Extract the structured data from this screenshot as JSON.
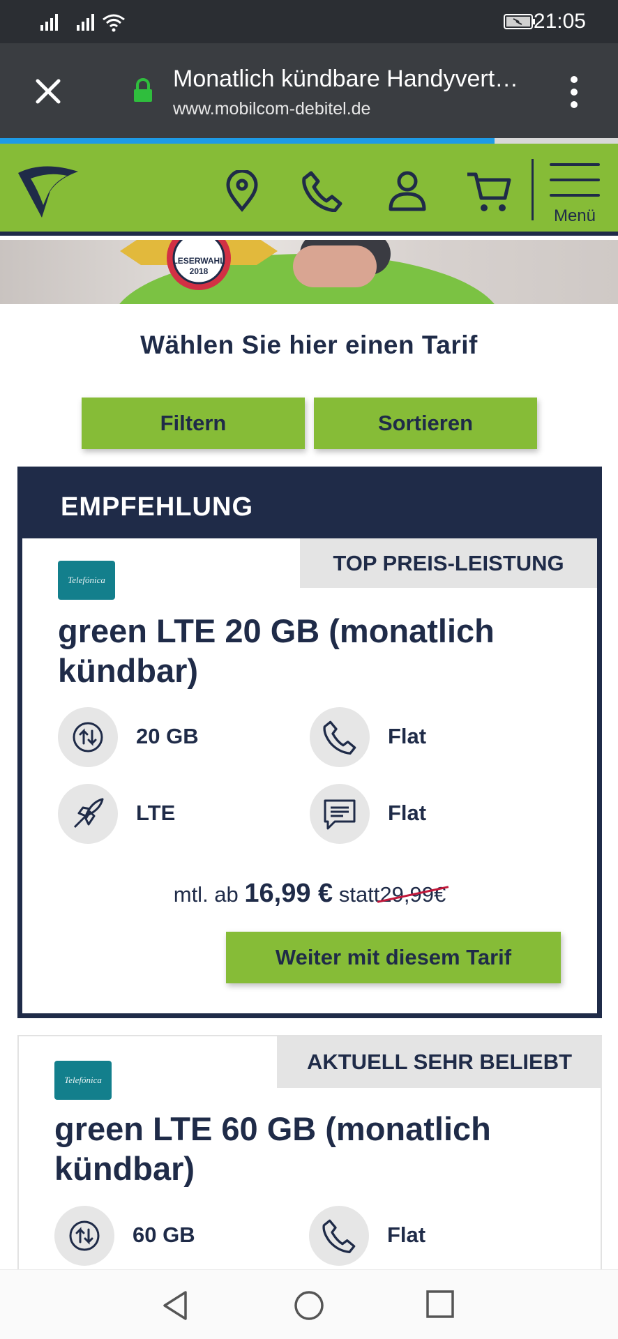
{
  "status_bar": {
    "time": "21:05"
  },
  "browser": {
    "title": "Monatlich kündbare Handyvert…",
    "url": "www.mobilcom-debitel.de",
    "load_progress": 0.8
  },
  "site_header": {
    "menu_label": "Menü",
    "icons": [
      "location-icon",
      "phone-icon",
      "user-icon",
      "cart-icon",
      "menu-icon"
    ]
  },
  "hero": {
    "badge_text": "LESERWAHL",
    "badge_year": "2018"
  },
  "section_title": "Wählen Sie hier einen Tarif",
  "actions": {
    "filter_label": "Filtern",
    "sort_label": "Sortieren"
  },
  "tariffs": [
    {
      "section_label": "EMPFEHLUNG",
      "tag": "TOP PREIS-LEISTUNG",
      "provider": "Telefónica",
      "title_line1": "green LTE 20 GB (monatlich",
      "title_line2": "kündbar)",
      "features": [
        {
          "icon": "data-transfer-icon",
          "label": "20 GB"
        },
        {
          "icon": "phone-icon",
          "label": "Flat"
        },
        {
          "icon": "rocket-icon",
          "label": "LTE"
        },
        {
          "icon": "message-icon",
          "label": "Flat"
        }
      ],
      "price_prefix": "mtl. ab",
      "price": "16,99 €",
      "price_mid": "statt",
      "price_old": "29,99€",
      "cta": "Weiter mit diesem Tarif"
    },
    {
      "tag": "AKTUELL SEHR BELIEBT",
      "provider": "Telefónica",
      "title_line1": "green LTE 60 GB (monatlich",
      "title_line2": "kündbar)",
      "features": [
        {
          "icon": "data-transfer-icon",
          "label": "60 GB"
        },
        {
          "icon": "phone-icon",
          "label": "Flat"
        }
      ]
    }
  ],
  "colors": {
    "brand_green": "#86bc37",
    "navy": "#1f2b48",
    "strike_red": "#c2183a",
    "progress_blue": "#1e9be6"
  }
}
